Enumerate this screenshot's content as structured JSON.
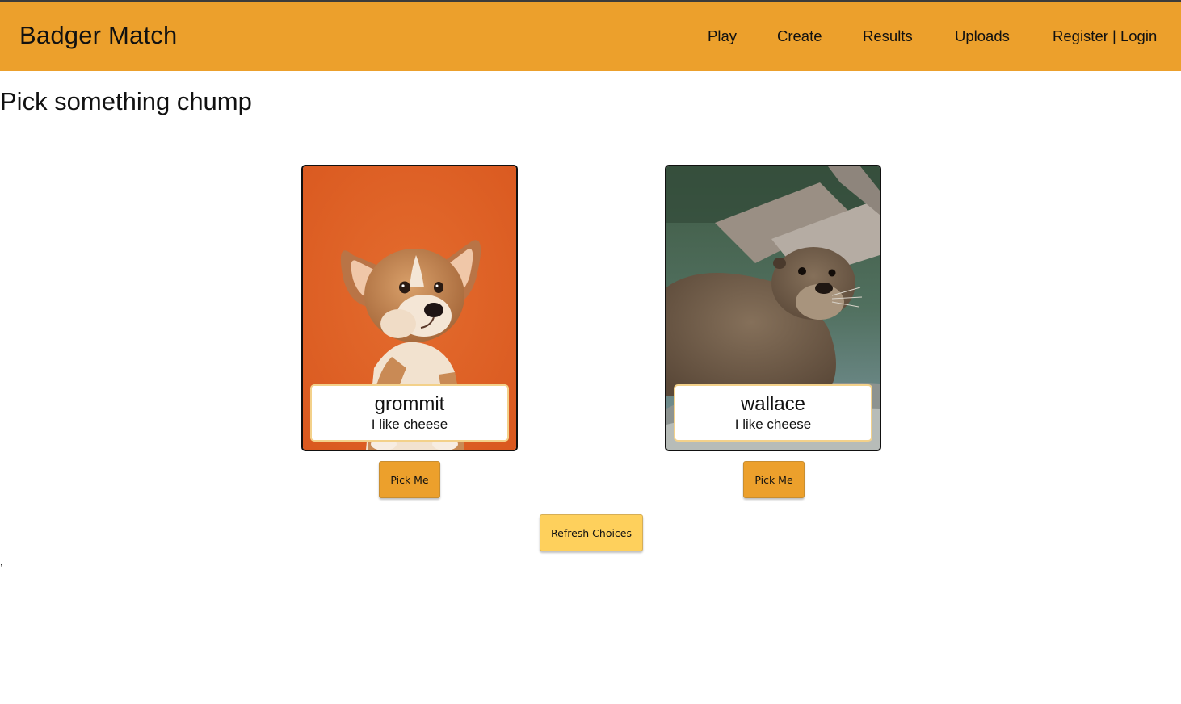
{
  "navbar": {
    "brand": "Badger Match",
    "links": [
      "Play",
      "Create",
      "Results",
      "Uploads",
      "Register | Login"
    ],
    "background": "#eca02c"
  },
  "page": {
    "title": "Pick something chump"
  },
  "cards": [
    {
      "name": "grommit",
      "bio": "I like cheese",
      "button_label": "Pick Me",
      "image": "corgi-puppy-photo"
    },
    {
      "name": "wallace",
      "bio": "I like cheese",
      "button_label": "Pick Me",
      "image": "otter-photo"
    }
  ],
  "refresh_label": "Refresh Choices",
  "stray_mark": ","
}
